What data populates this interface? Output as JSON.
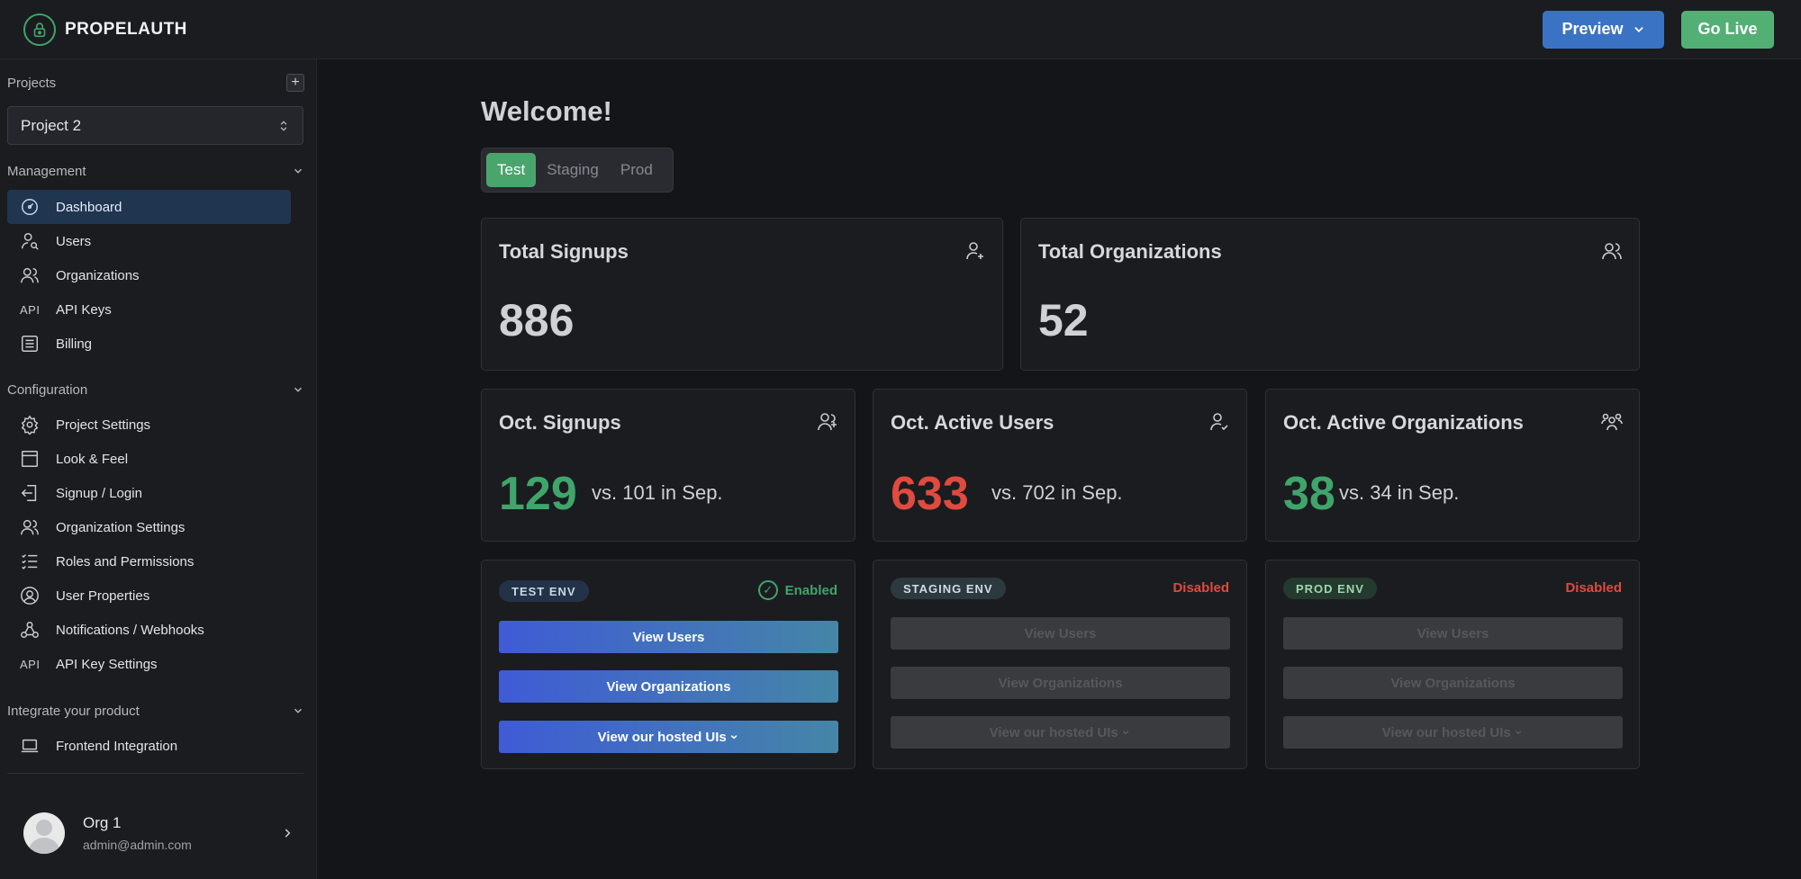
{
  "brand": {
    "name": "PROPELAUTH"
  },
  "header": {
    "preview_label": "Preview",
    "golive_label": "Go Live"
  },
  "sidebar": {
    "projects_label": "Projects",
    "add_symbol": "+",
    "selected_project": "Project 2",
    "management": {
      "label": "Management",
      "items": [
        {
          "label": "Dashboard",
          "icon": "dashboard-icon"
        },
        {
          "label": "Users",
          "icon": "user-search-icon"
        },
        {
          "label": "Organizations",
          "icon": "users-icon"
        },
        {
          "label": "API Keys",
          "icon": "api-icon",
          "icon_text": "API"
        },
        {
          "label": "Billing",
          "icon": "billing-icon"
        }
      ]
    },
    "configuration": {
      "label": "Configuration",
      "items": [
        {
          "label": "Project Settings",
          "icon": "gear-icon"
        },
        {
          "label": "Look & Feel",
          "icon": "browser-icon"
        },
        {
          "label": "Signup / Login",
          "icon": "login-icon"
        },
        {
          "label": "Organization Settings",
          "icon": "users-icon"
        },
        {
          "label": "Roles and Permissions",
          "icon": "checklist-icon"
        },
        {
          "label": "User Properties",
          "icon": "user-circle-icon"
        },
        {
          "label": "Notifications / Webhooks",
          "icon": "webhook-icon"
        },
        {
          "label": "API Key Settings",
          "icon": "api-icon",
          "icon_text": "API"
        }
      ]
    },
    "integrate": {
      "label": "Integrate your product",
      "items": [
        {
          "label": "Frontend Integration",
          "icon": "laptop-icon"
        }
      ]
    },
    "org": {
      "name": "Org 1",
      "email": "admin@admin.com"
    }
  },
  "main": {
    "welcome": "Welcome!",
    "env_tabs": [
      "Test",
      "Staging",
      "Prod"
    ],
    "total_signups": {
      "title": "Total Signups",
      "value": "886"
    },
    "total_orgs": {
      "title": "Total Organizations",
      "value": "52"
    },
    "oct_signups": {
      "title": "Oct. Signups",
      "value": "129",
      "compare": "vs. 101 in Sep."
    },
    "oct_active_users": {
      "title": "Oct. Active Users",
      "value": "633",
      "compare": "vs. 702 in Sep."
    },
    "oct_active_orgs": {
      "title": "Oct. Active Organizations",
      "value": "38",
      "compare": "vs. 34 in Sep."
    },
    "envs": [
      {
        "badge": "TEST ENV",
        "status": "Enabled",
        "buttons": [
          "View Users",
          "View Organizations",
          "View our hosted UIs"
        ]
      },
      {
        "badge": "STAGING ENV",
        "status": "Disabled",
        "buttons": [
          "View Users",
          "View Organizations",
          "View our hosted UIs"
        ]
      },
      {
        "badge": "PROD ENV",
        "status": "Disabled",
        "buttons": [
          "View Users",
          "View Organizations",
          "View our hosted UIs"
        ]
      }
    ],
    "dropdown_glyph": "⌄"
  },
  "colors": {
    "accent_green": "#3fa56a",
    "accent_red": "#e04a3f",
    "accent_blue": "#3a73c4"
  }
}
